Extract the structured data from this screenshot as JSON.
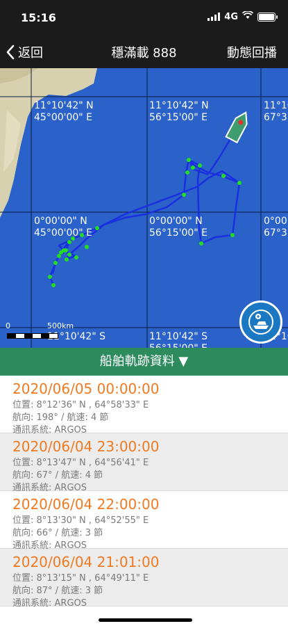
{
  "status": {
    "time": "15:16",
    "network": "4G"
  },
  "nav": {
    "back_label": "返回",
    "title": "穩滿載 888",
    "replay_label": "動態回播"
  },
  "map": {
    "coords": [
      "11°10'42\" N\n45°00'00\" E",
      "11°10'42\" N\n56°15'00\" E",
      "11°10'42\" N\n67°3",
      "0°00'00\" N\n45°00'00\" E",
      "0°00'00\" N\n56°15'00\" E",
      "0°00'00\" N\n67°3",
      "11°10'42\" S\n56°15'00\" E",
      "11°10'42\" S",
      "11°10'"
    ],
    "scale_labels": [
      "0",
      "500km"
    ],
    "colors": {
      "ocean": "#2a62c9",
      "track": "#1a2fe0",
      "point": "#22dd22",
      "grid": "#0d1a3a"
    }
  },
  "section_header": "船舶軌跡資料 ▼",
  "records": [
    {
      "time": "2020/06/05 00:00:00",
      "position": "位置: 8°12'36\" N , 64°58'33\" E",
      "course": "航向: 198° / 航速: 4 節",
      "comm": "通訊系統: ARGOS"
    },
    {
      "time": "2020/06/04 23:00:00",
      "position": "位置: 8°13'47\" N , 64°56'41\" E",
      "course": "航向: 67° / 航速: 4 節",
      "comm": "通訊系統: ARGOS"
    },
    {
      "time": "2020/06/04 22:00:00",
      "position": "位置: 8°13'30\" N , 64°52'55\" E",
      "course": "航向: 66° / 航速: 3 節",
      "comm": "通訊系統: ARGOS"
    },
    {
      "time": "2020/06/04 21:01:00",
      "position": "位置: 8°13'15\" N , 64°49'11\" E",
      "course": "航向: 87° / 航速: 3 節",
      "comm": "通訊系統: ARGOS"
    }
  ]
}
